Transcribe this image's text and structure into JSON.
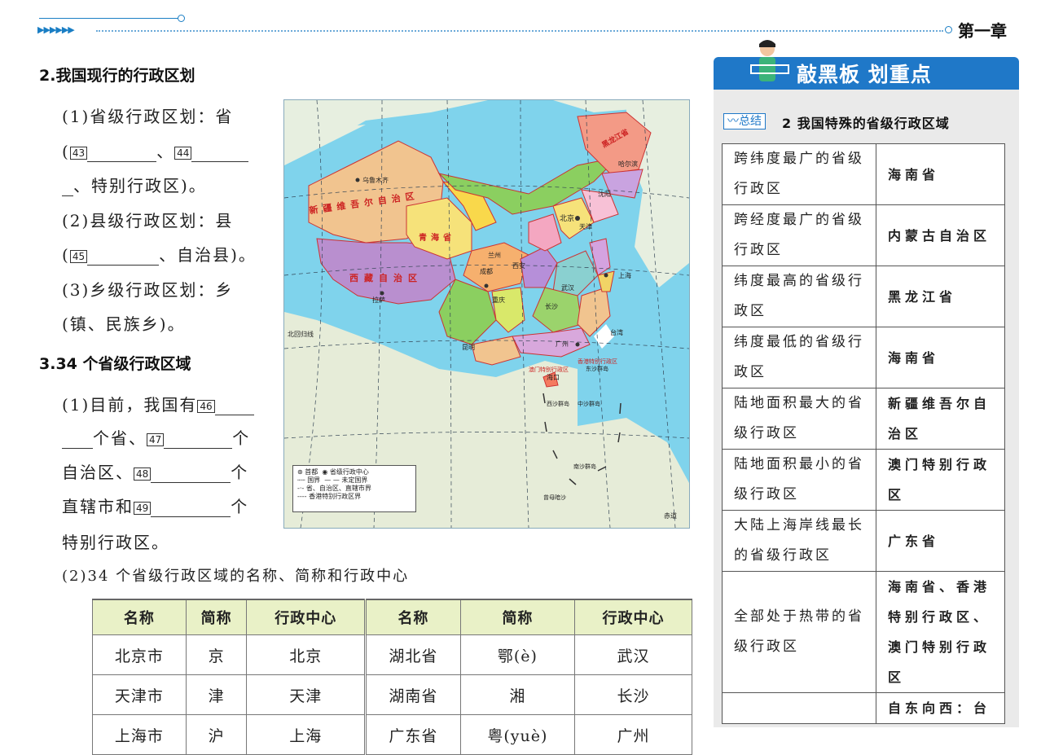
{
  "header": {
    "chapter": "第一章"
  },
  "section2": {
    "title": "2.我国现行的行政区划",
    "l1": "(1)省级行政区划：省",
    "b43": "43",
    "b44": "44",
    "l2": "、特别行政区)。",
    "l3": "(2)县级行政区划：县",
    "b45": "45",
    "l4": "、自治县)。",
    "l5": "(3)乡级行政区划：乡",
    "l6": "(镇、民族乡)。"
  },
  "section3": {
    "title": "3.34 个省级行政区域",
    "l1": "(1)目前，我国有",
    "b46": "46",
    "l2": "个省、",
    "b47": "47",
    "ge": "个",
    "l3": "自治区、",
    "b48": "48",
    "l4": "直辖市和",
    "b49": "49",
    "l5": "特别行政区。",
    "l6": "(2)34 个省级行政区域的名称、简称和行政中心"
  },
  "map": {
    "labels": [
      "新疆维吾尔自治区",
      "西藏自治区",
      "青海省",
      "乌鲁木齐",
      "拉萨",
      "北京",
      "上海",
      "天津",
      "广州",
      "香港特别行政区",
      "澳门特别行政区",
      "台湾",
      "海口",
      "成都",
      "重庆",
      "武汉",
      "长沙",
      "昆明",
      "西安",
      "兰州",
      "沈阳",
      "哈尔滨",
      "黑龙江省",
      "西沙群岛",
      "中沙群岛",
      "南沙群岛",
      "东沙群岛",
      "曾母暗沙",
      "北回归线",
      "赤道"
    ],
    "legend": [
      "首都",
      "省级行政中心",
      "国界",
      "未定国界",
      "省、自治区、直辖市界",
      "香港特别行政区界"
    ]
  },
  "table": {
    "headers": [
      "名称",
      "简称",
      "行政中心",
      "名称",
      "简称",
      "行政中心"
    ],
    "rows": [
      [
        "北京市",
        "京",
        "北京",
        "湖北省",
        "鄂(è)",
        "武汉"
      ],
      [
        "天津市",
        "津",
        "天津",
        "湖南省",
        "湘",
        "长沙"
      ],
      [
        "上海市",
        "沪",
        "上海",
        "广东省",
        "粤(yuè)",
        "广州"
      ]
    ]
  },
  "panel": {
    "banner": "敲黑板  划重点",
    "badge": "总结",
    "summary_title": "2  我国特殊的省级行政区域",
    "rows": [
      [
        "跨纬度最广的省级行政区",
        "海南省"
      ],
      [
        "跨经度最广的省级行政区",
        "内蒙古自治区"
      ],
      [
        "纬度最高的省级行政区",
        "黑龙江省"
      ],
      [
        "纬度最低的省级行政区",
        "海南省"
      ],
      [
        "陆地面积最大的省级行政区",
        "新疆维吾尔自治区"
      ],
      [
        "陆地面积最小的省级行政区",
        "澳门特别行政区"
      ],
      [
        "大陆上海岸线最长的省级行政区",
        "广东省"
      ],
      [
        "全部处于热带的省级行政区",
        "海南省、香港特别行政区、澳门特别行政区"
      ],
      [
        "",
        "自东向西：台"
      ]
    ]
  }
}
